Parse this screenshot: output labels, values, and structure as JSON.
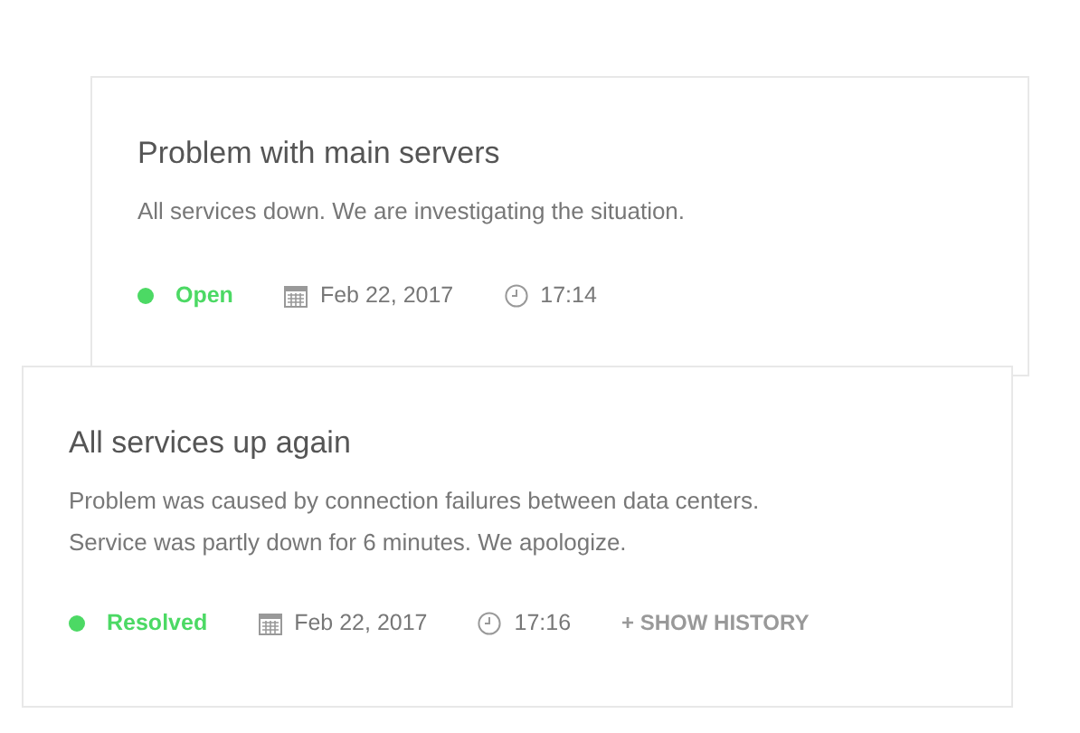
{
  "incidents": [
    {
      "title": "Problem with main servers",
      "lines": [
        "All services down. We are investigating the situation."
      ],
      "status": {
        "label": "Open",
        "color": "#4cd964"
      },
      "date": "Feb 22, 2017",
      "time": "17:14"
    },
    {
      "title": "All services up again",
      "lines": [
        "Problem was caused by connection failures between data centers.",
        "Service was partly down for 6 minutes. We apologize."
      ],
      "status": {
        "label": "Resolved",
        "color": "#4cd964"
      },
      "date": "Feb 22, 2017",
      "time": "17:16",
      "history_link": "+ SHOW HISTORY"
    }
  ]
}
